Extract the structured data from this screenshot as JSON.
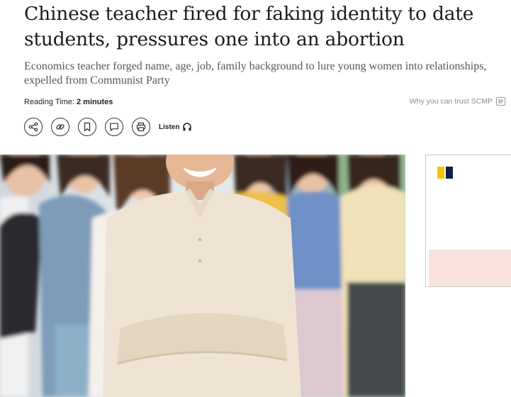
{
  "article": {
    "headline": "Chinese teacher fired for faking identity to date students, pressures one into an abortion",
    "subheadline": "Economics teacher forged name, age, job, family background to lure young women into relationships, expelled from Communist Party",
    "reading_time_label": "Reading Time:",
    "reading_time_value": "2 minutes",
    "trust_link": "Why you can trust SCMP"
  },
  "toolbar": {
    "buttons": [
      {
        "icon": "share-icon"
      },
      {
        "icon": "link-icon"
      },
      {
        "icon": "bookmark-icon"
      },
      {
        "icon": "comment-icon"
      },
      {
        "icon": "print-icon"
      }
    ],
    "listen_label": "Listen",
    "listen_icon": "headphones-icon"
  },
  "hero_image": {
    "description_icon": "photo"
  },
  "ad": {
    "logo_colors": [
      "#f5c400",
      "#0b1f4b"
    ],
    "band_color": "#f9e1dd"
  }
}
